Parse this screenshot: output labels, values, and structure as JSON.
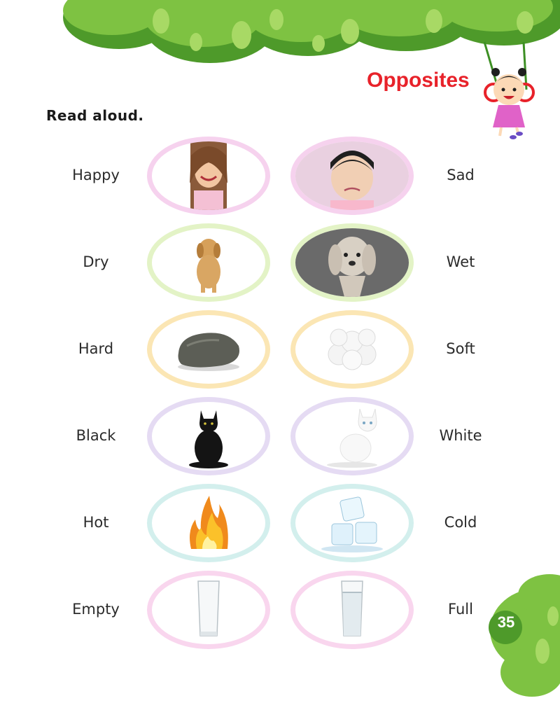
{
  "header": {
    "title": "Opposites"
  },
  "instruction": "Read aloud.",
  "pairs": [
    {
      "left": "Happy",
      "right": "Sad",
      "left_image": "smiling-girl-photo",
      "right_image": "sad-toddler-photo",
      "ring_color": "#f6d2ee"
    },
    {
      "left": "Dry",
      "right": "Wet",
      "left_image": "dry-dog-photo",
      "right_image": "wet-dog-photo",
      "ring_color": "#e3f3c6"
    },
    {
      "left": "Hard",
      "right": "Soft",
      "left_image": "rock-photo",
      "right_image": "cotton-balls-photo",
      "ring_color": "#fbe6b4"
    },
    {
      "left": "Black",
      "right": "White",
      "left_image": "black-cat-photo",
      "right_image": "white-kitten-photo",
      "ring_color": "#e5dbf3"
    },
    {
      "left": "Hot",
      "right": "Cold",
      "left_image": "fire-photo",
      "right_image": "ice-cubes-photo",
      "ring_color": "#d3efed"
    },
    {
      "left": "Empty",
      "right": "Full",
      "left_image": "empty-glass-photo",
      "right_image": "full-glass-photo",
      "ring_color": "#f9d6ee"
    }
  ],
  "page_number": "35",
  "colors": {
    "title": "#e8222a",
    "leaf_green": "#7ec242",
    "leaf_dark": "#4e9a2a"
  }
}
